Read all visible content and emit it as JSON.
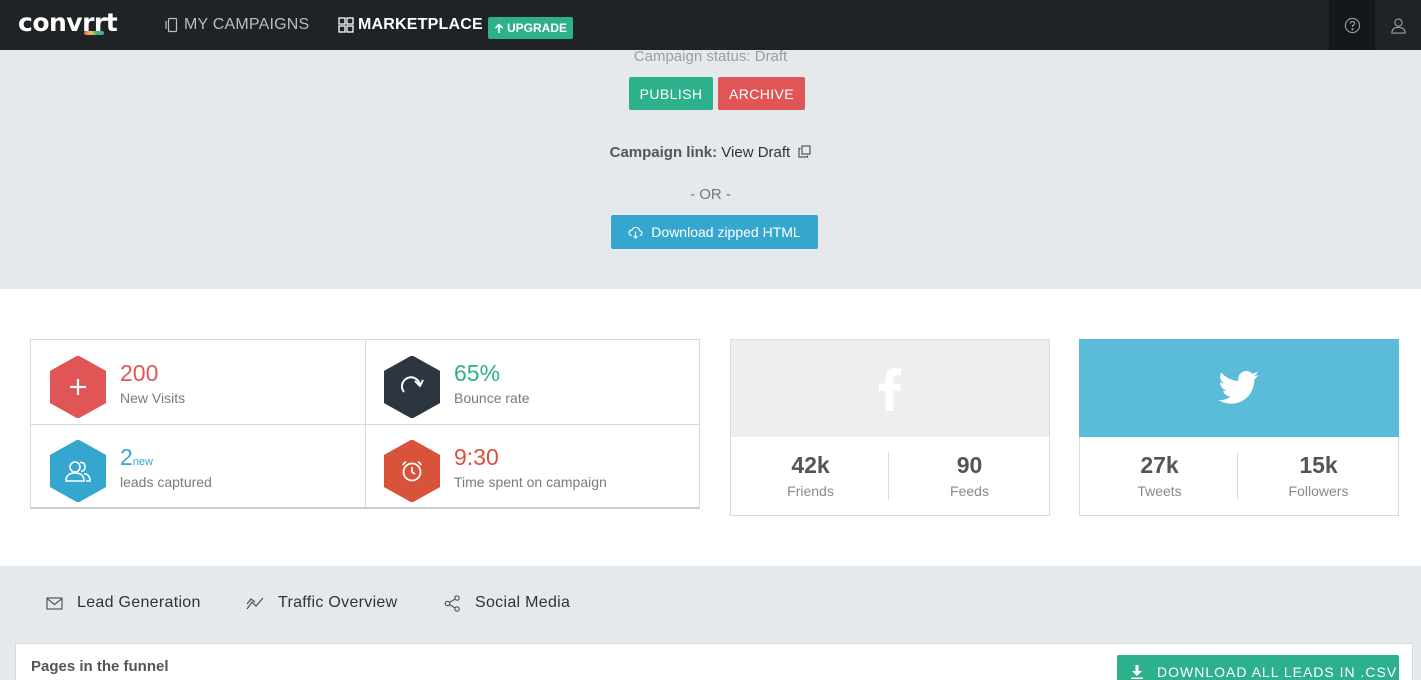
{
  "nav": {
    "logo": "convrrt",
    "my_campaigns": "MY CAMPAIGNS",
    "marketplace": "MARKETPLACE",
    "upgrade": "UPGRADE"
  },
  "campaign": {
    "status_text": "Campaign status: Draft",
    "publish_label": "PUBLISH",
    "archive_label": "ARCHIVE",
    "link_label": "Campaign link:",
    "link_text": "View Draft",
    "or_text": "- OR -",
    "download_label": "Download zipped HTML"
  },
  "stats": [
    {
      "value": "200",
      "suffix": "",
      "label": "New Visits",
      "color": "#e05656",
      "icon": "plus-icon"
    },
    {
      "value": "65%",
      "suffix": "",
      "label": "Bounce rate",
      "color": "#2db08c",
      "icon": "refresh-icon"
    },
    {
      "value": "2",
      "suffix": "new",
      "label": "leads captured",
      "color": "#35a7cf",
      "icon": "users-icon"
    },
    {
      "value": "9:30",
      "suffix": "",
      "label": "Time spent on campaign",
      "color": "#d9533b",
      "icon": "alarm-clock-icon"
    }
  ],
  "facebook": {
    "friends_value": "42k",
    "friends_label": "Friends",
    "feeds_value": "90",
    "feeds_label": "Feeds"
  },
  "twitter": {
    "tweets_value": "27k",
    "tweets_label": "Tweets",
    "followers_value": "15k",
    "followers_label": "Followers"
  },
  "tabs": {
    "lead_generation": "Lead Generation",
    "traffic_overview": "Traffic Overview",
    "social_media": "Social Media"
  },
  "funnel": {
    "title": "Pages in the funnel",
    "download_csv_label": "DOWNLOAD ALL LEADS IN .CSV"
  },
  "colors": {
    "navbar": "#1f2326",
    "green": "#2db08c",
    "red": "#e05656",
    "blue": "#35a7cf",
    "dark": "#2c3540",
    "twitter": "#5bbcd9"
  }
}
